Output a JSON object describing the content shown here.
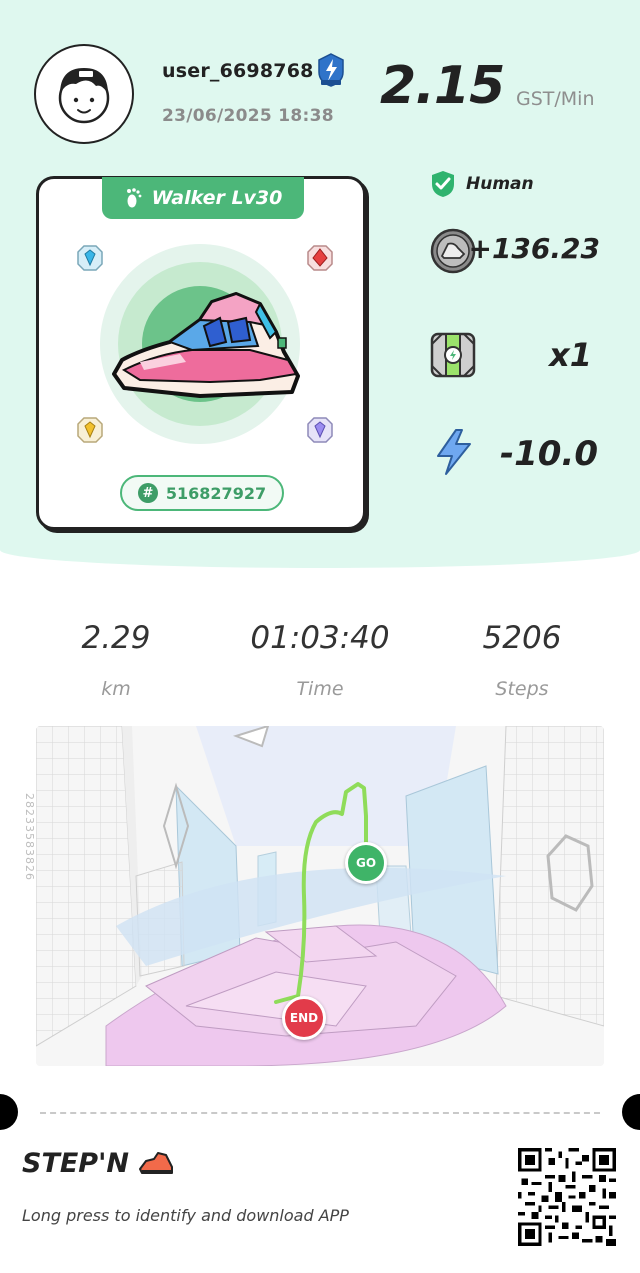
{
  "profile": {
    "username": "user_6698768",
    "datetime": "23/06/2025 18:38",
    "avatar_icon": "person-avatar-icon",
    "badge_icon": "lightning-shield-badge-icon"
  },
  "rate": {
    "value": "2.15",
    "unit": "GST/Min"
  },
  "sneaker": {
    "level_label": "Walker Lv30",
    "level_icon": "footprint-icon",
    "id": "516827927",
    "gems": [
      "blue-gem-icon",
      "red-gem-icon",
      "yellow-gem-icon",
      "purple-gem-icon"
    ]
  },
  "stats": {
    "human_label": "Human",
    "earned": "+136.23",
    "multiplier": "x1",
    "energy": "-10.0"
  },
  "metrics": [
    {
      "value": "2.29",
      "label": "km"
    },
    {
      "value": "01:03:40",
      "label": "Time"
    },
    {
      "value": "5206",
      "label": "Steps"
    }
  ],
  "map": {
    "start_label": "GO",
    "end_label": "END",
    "side_code": "28233583826"
  },
  "footer": {
    "brand": "STEP'N",
    "cta": "Long press to identify and download APP"
  },
  "colors": {
    "mint_bg": "#dff8ef",
    "green": "#4cb779",
    "route": "#8fdc5a",
    "end_red": "#e23b4a"
  }
}
